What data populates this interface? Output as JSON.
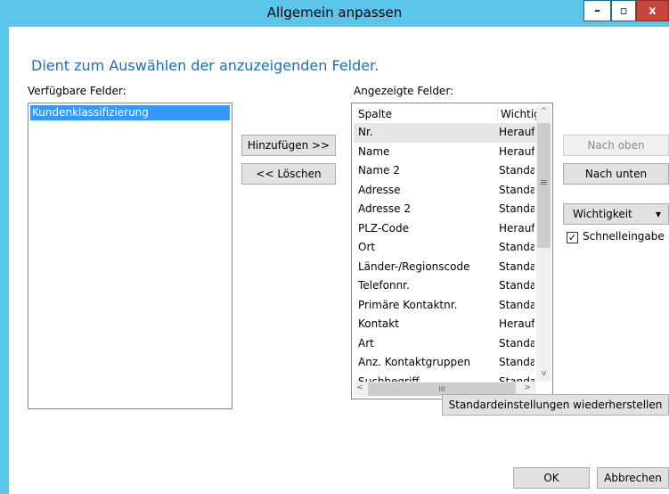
{
  "window": {
    "title": "Allgemein anpassen",
    "minimize": "–",
    "maximize": "▫",
    "close": "x"
  },
  "heading": "Dient zum Auswählen der anzuzeigenden Felder.",
  "available": {
    "label": "Verfügbare Felder:",
    "items": [
      "Kundenklassifizierung"
    ]
  },
  "buttons": {
    "add": "Hinzufügen >>",
    "remove": "<< Löschen",
    "move_up": "Nach oben",
    "move_down": "Nach unten",
    "importance": "Wichtigkeit",
    "importance_arrow": "▾",
    "restore": "Standardeinstellungen wiederherstellen",
    "ok": "OK",
    "cancel": "Abbrechen"
  },
  "displayed": {
    "label": "Angezeigte Felder:",
    "col_field": "Spalte",
    "col_importance": "Wichtig",
    "rows": [
      {
        "field": "Nr.",
        "importance": "Herauf"
      },
      {
        "field": "Name",
        "importance": "Herauf"
      },
      {
        "field": "Name 2",
        "importance": "Standa"
      },
      {
        "field": "Adresse",
        "importance": "Standa"
      },
      {
        "field": "Adresse 2",
        "importance": "Standa"
      },
      {
        "field": "PLZ-Code",
        "importance": "Herauf"
      },
      {
        "field": "Ort",
        "importance": "Standa"
      },
      {
        "field": "Länder-/Regionscode",
        "importance": "Standa"
      },
      {
        "field": "Telefonnr.",
        "importance": "Standa"
      },
      {
        "field": "Primäre Kontaktnr.",
        "importance": "Standa"
      },
      {
        "field": "Kontakt",
        "importance": "Herauf"
      },
      {
        "field": "Art",
        "importance": "Standa"
      },
      {
        "field": "Anz. Kontaktgruppen",
        "importance": "Standa"
      },
      {
        "field": "Suchbegriff",
        "importance": "Standa"
      }
    ],
    "scroll_up": "^",
    "scroll_down": "v",
    "scroll_left": "<",
    "scroll_right": ">",
    "thumb_grip": "≡",
    "hthumb_grip": "III"
  },
  "quick_entry": {
    "label": "Schnelleingabe",
    "checked": true,
    "check_mark": "✓"
  }
}
